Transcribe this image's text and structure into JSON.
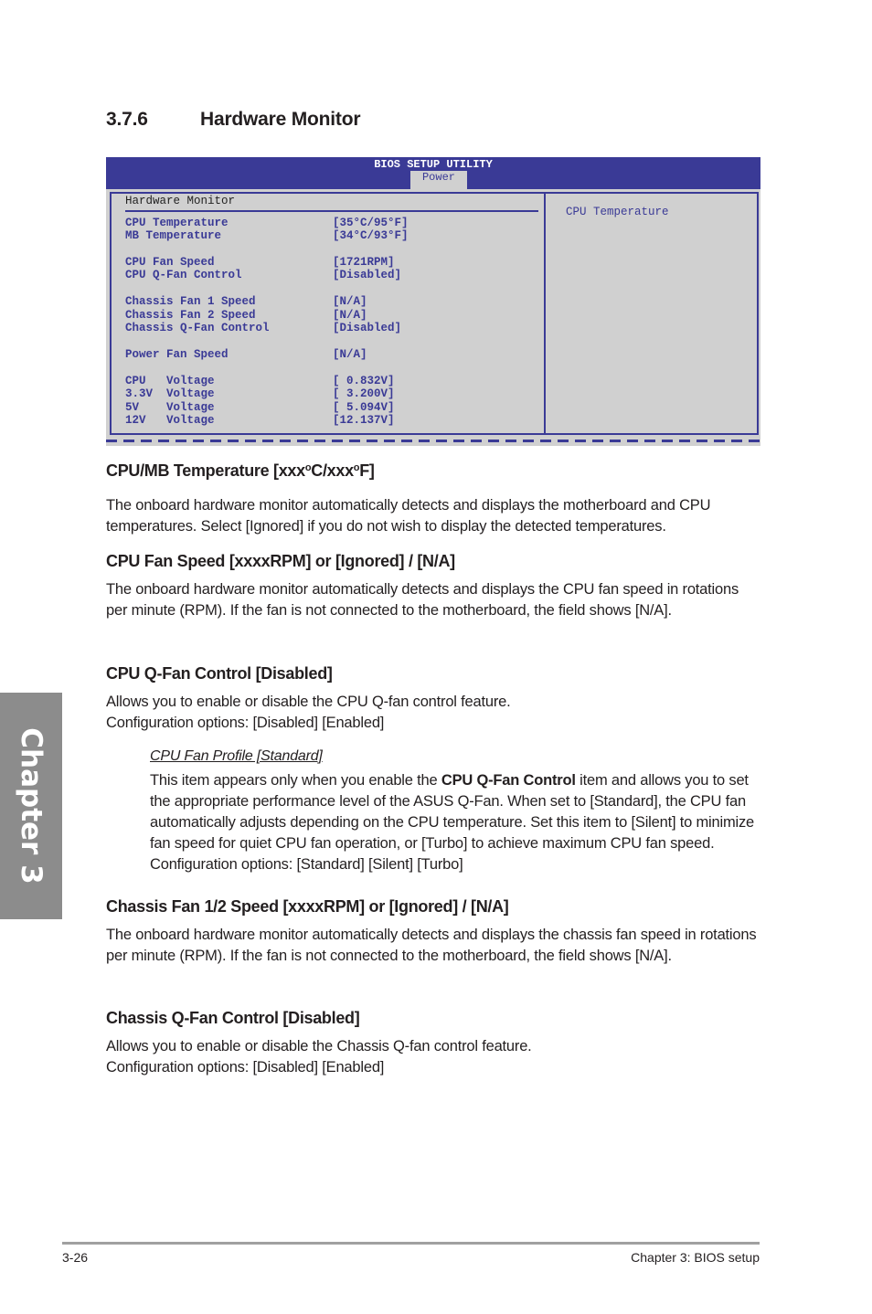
{
  "section": {
    "number": "3.7.6",
    "title": "Hardware Monitor"
  },
  "bios": {
    "title": "BIOS SETUP UTILITY",
    "active_tab": "Power",
    "panel_title": "Hardware Monitor",
    "help_text": "CPU Temperature",
    "items": [
      {
        "label": "CPU Temperature",
        "value": "[35°C/95°F]"
      },
      {
        "label": "MB Temperature",
        "value": "[34°C/93°F]"
      },
      {
        "label": "CPU Fan Speed",
        "value": "[1721RPM]"
      },
      {
        "label": "CPU Q-Fan Control",
        "value": "[Disabled]"
      },
      {
        "label": "Chassis Fan 1 Speed",
        "value": "[N/A]"
      },
      {
        "label": "Chassis Fan 2 Speed",
        "value": "[N/A]"
      },
      {
        "label": "Chassis Q-Fan Control",
        "value": "[Disabled]"
      },
      {
        "label": "Power Fan Speed",
        "value": "[N/A]"
      },
      {
        "label": "CPU   Voltage",
        "value": "[ 0.832V]"
      },
      {
        "label": "3.3V  Voltage",
        "value": "[ 3.200V]"
      },
      {
        "label": "5V    Voltage",
        "value": "[ 5.094V]"
      },
      {
        "label": "12V   Voltage",
        "value": "[12.137V]"
      }
    ]
  },
  "content": {
    "temp_heading_a": "CPU/MB Temperature [xxx",
    "temp_heading_deg": "o",
    "temp_heading_b": "C/xxx",
    "temp_heading_c": "F]",
    "temp_desc": "The onboard hardware monitor automatically detects and displays the motherboard and CPU temperatures. Select [Ignored] if you do not wish to display the detected temperatures.",
    "cpu_fan_heading": "CPU Fan Speed [xxxxRPM] or [Ignored] / [N/A]",
    "cpu_fan_desc": "The onboard hardware monitor automatically detects and displays the CPU fan speed in rotations per minute (RPM). If the fan is not connected to the motherboard, the field shows [N/A].",
    "cpu_qfan_heading": "CPU Q-Fan Control [Disabled]",
    "cpu_qfan_desc_1": "Allows you to enable or disable the CPU Q-fan control feature.",
    "cpu_qfan_desc_2": "Configuration options: [Disabled] [Enabled]",
    "profile_heading": "CPU Fan Profile [Standard]",
    "profile_desc_a": "This item appears only when you enable the ",
    "profile_desc_bold": "CPU Q-Fan Control",
    "profile_desc_b": " item and allows you to set the appropriate performance level of the ASUS Q-Fan. When set to [Standard], the CPU fan automatically adjusts depending on the CPU temperature. Set this item to [Silent] to minimize fan speed for quiet CPU fan operation, or [Turbo] to achieve maximum CPU fan speed. Configuration options: [Standard] [Silent] [Turbo]",
    "chassis_fan_heading": "Chassis Fan 1/2 Speed [xxxxRPM] or [Ignored] / [N/A]",
    "chassis_fan_desc": "The onboard hardware monitor automatically detects and displays the chassis fan speed in rotations per minute (RPM). If the fan is not connected to the motherboard, the field shows [N/A].",
    "chassis_qfan_heading": "Chassis Q-Fan Control [Disabled]",
    "chassis_qfan_desc_1": "Allows you to enable or disable the Chassis Q-fan control feature.",
    "chassis_qfan_desc_2": "Configuration options: [Disabled] [Enabled]"
  },
  "chapter_tab": "Chapter 3",
  "footer": {
    "page": "3-26",
    "chapter": "Chapter 3: BIOS setup"
  }
}
